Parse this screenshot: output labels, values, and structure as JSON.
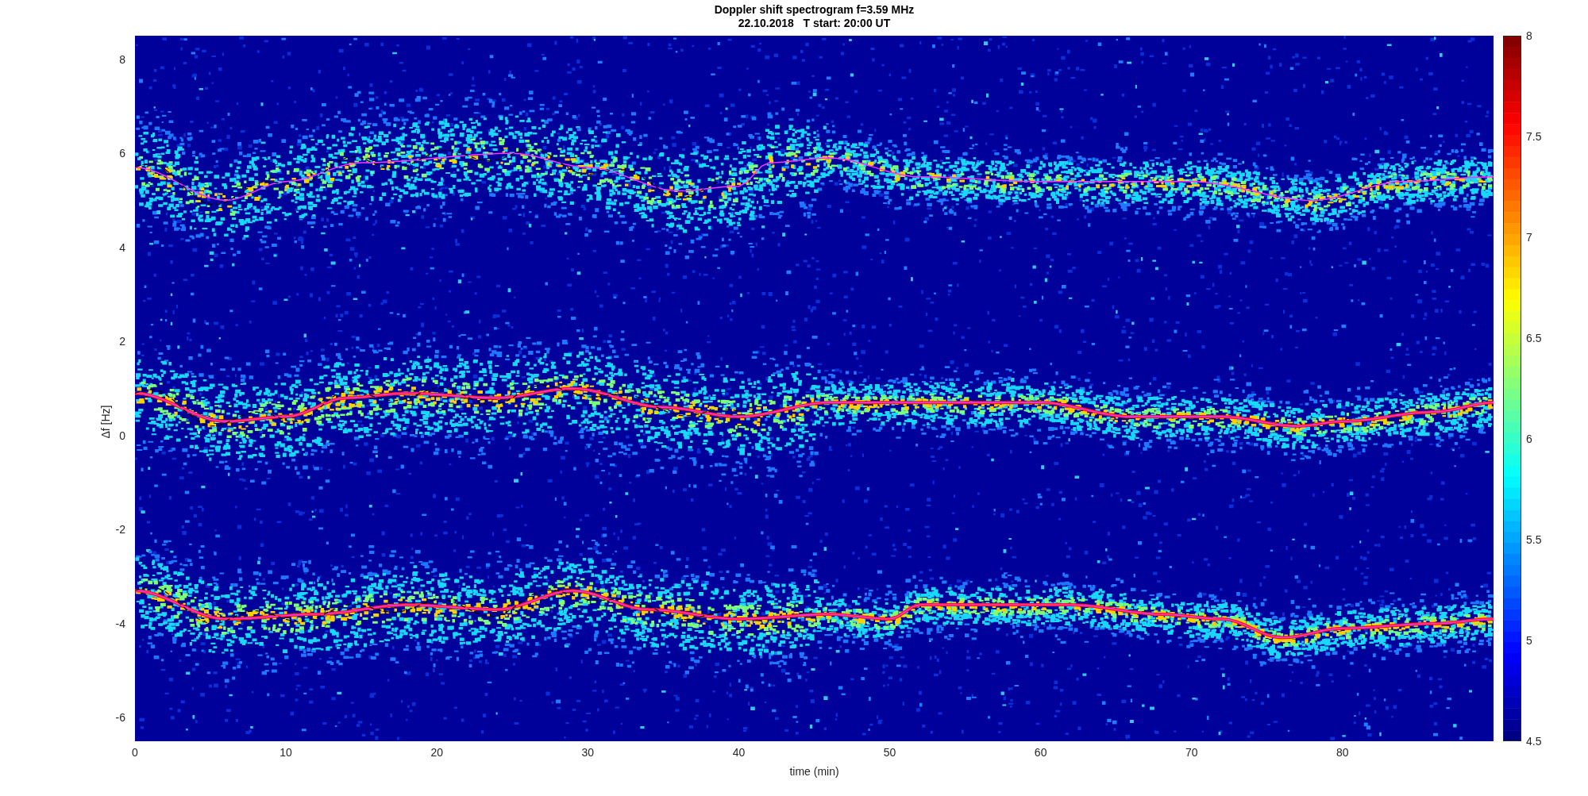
{
  "figure": {
    "title_lines": [
      "Doppler shift spectrogram f=3.59 MHz",
      "22.10.2018   T start: 20:00 UT"
    ],
    "axes": {
      "xlabel": "time (min)",
      "ylabel": "Δf [Hz]",
      "xticks": [
        "0",
        "10",
        "20",
        "30",
        "40",
        "50",
        "60",
        "70",
        "80"
      ],
      "yticks": [
        "8",
        "6",
        "4",
        "2",
        "0",
        "-2",
        "-4",
        "-6"
      ]
    },
    "colorbar": {
      "ticks": [
        "8",
        "7.5",
        "7",
        "6.5",
        "6",
        "5.5",
        "5",
        "4.5"
      ]
    }
  }
}
